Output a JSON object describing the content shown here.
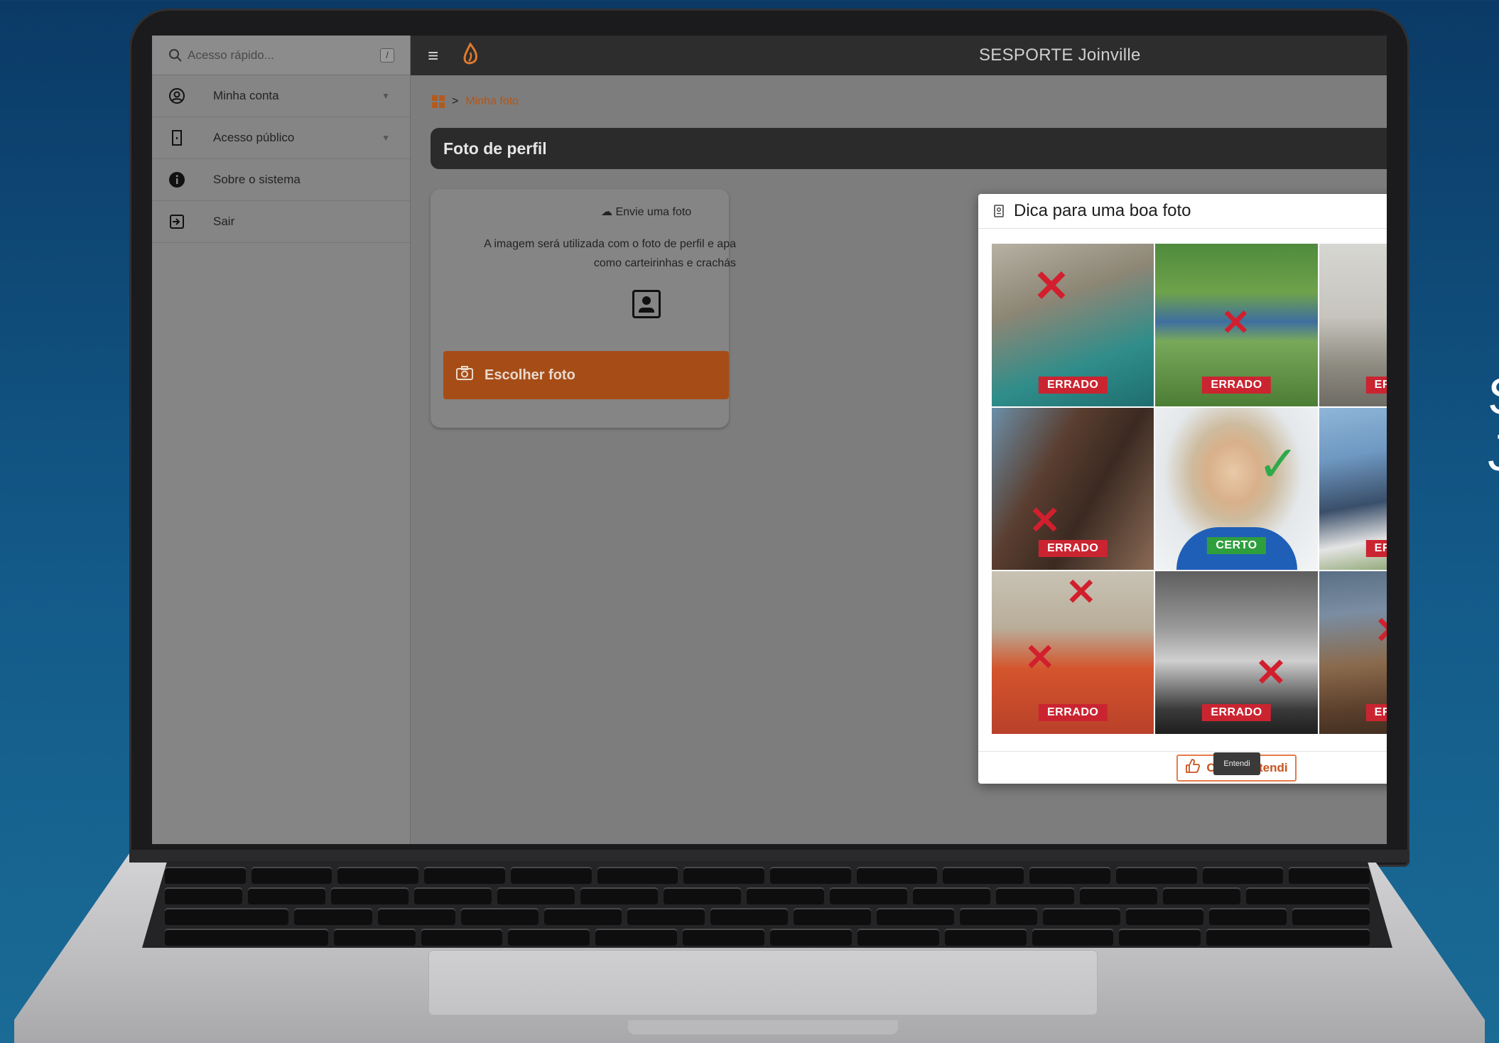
{
  "app": {
    "title": "SESPORTE Joinville"
  },
  "search": {
    "placeholder": "Acesso rápido...",
    "shortcut": "/"
  },
  "sidebar": {
    "items": [
      {
        "label": "Minha conta",
        "icon": "account-circle-icon",
        "has_submenu": true
      },
      {
        "label": "Acesso público",
        "icon": "door-icon",
        "has_submenu": true
      },
      {
        "label": "Sobre o sistema",
        "icon": "info-icon",
        "has_submenu": false
      },
      {
        "label": "Sair",
        "icon": "logout-icon",
        "has_submenu": false
      }
    ]
  },
  "breadcrumb": {
    "separator": ">",
    "current": "Minha foto"
  },
  "page": {
    "title": "Foto de perfil"
  },
  "upload_card": {
    "heading": "Envie uma foto",
    "description_line1": "A imagem será utilizada com o foto de perfil e apa",
    "description_line2": "como carteirinhas e crachás",
    "choose_button": "Escolher foto"
  },
  "modal": {
    "title": "Dica para uma boa foto",
    "tiles": [
      {
        "label": "ERRADO",
        "ok": false
      },
      {
        "label": "ERRADO",
        "ok": false
      },
      {
        "label": "ERRADO",
        "ok": false
      },
      {
        "label": "ERRADO",
        "ok": false
      },
      {
        "label": "CERTO",
        "ok": true
      },
      {
        "label": "ERRADO",
        "ok": false
      },
      {
        "label": "ERRADO",
        "ok": false
      },
      {
        "label": "ERRADO",
        "ok": false
      },
      {
        "label": "ERRADO",
        "ok": false
      }
    ],
    "confirm_button": "Certo, entendi"
  },
  "tooltip": {
    "text": "Entendi"
  },
  "colors": {
    "accent": "#c9531d",
    "wrong": "#cb2431",
    "right": "#2f9f3e",
    "topbar": "#2d2d2d"
  }
}
